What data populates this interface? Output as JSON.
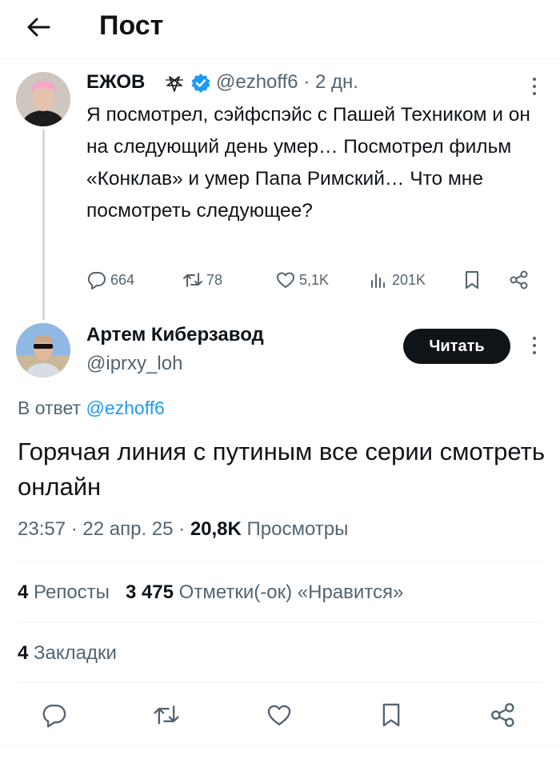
{
  "header": {
    "title": "Пост"
  },
  "parent_tweet": {
    "author_name": "ЕЖОВ",
    "handle_time": "@ezhoff6 · 2 дн.",
    "text": "Я посмотрел, сэйфспэйс с Пашей Техником и он на следующий день умер… Посмотрел фильм «Конклав» и умер Папа Римский… Что мне посмотреть следующее?",
    "stats": {
      "replies": "664",
      "reposts": "78",
      "likes": "5,1K",
      "views": "201K"
    }
  },
  "main_tweet": {
    "author_name": "Артем Киберзавод",
    "handle": "@iprxy_loh",
    "follow_label": "Читать",
    "reply_prefix": "В ответ ",
    "reply_mention": "@ezhoff6",
    "text": "Горячая линия с путиным все серии смотреть онлайн",
    "time_date": "23:57 · 22 апр. 25 · ",
    "views_count": "20,8K",
    "views_label": " Просмотры",
    "reposts_count": "4",
    "reposts_label": " Репосты",
    "likes_count": "3 475",
    "likes_label": " Отметки(-ок) «Нравится»",
    "bookmarks_count": "4",
    "bookmarks_label": " Закладки"
  },
  "colors": {
    "accent": "#1d9bf0",
    "text": "#0f1419",
    "muted": "#536471",
    "divider": "#eff3f4"
  },
  "icons": [
    "back-arrow-icon",
    "pentagram-icon",
    "verified-badge-icon",
    "more-icon",
    "reply-icon",
    "repost-icon",
    "like-icon",
    "views-icon",
    "bookmark-icon",
    "share-icon"
  ]
}
